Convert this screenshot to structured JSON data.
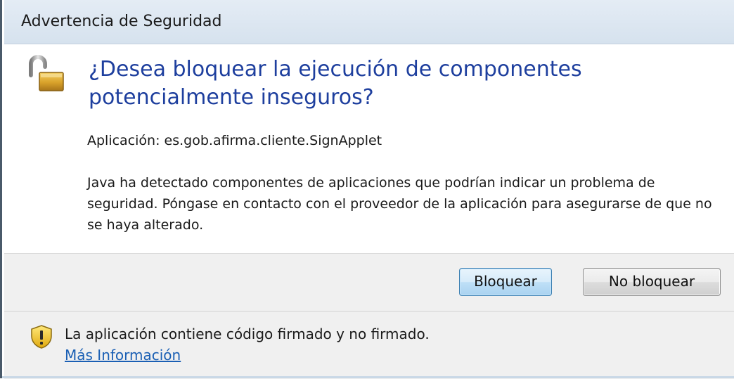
{
  "window": {
    "title": "Advertencia de Seguridad"
  },
  "content": {
    "heading": "¿Desea bloquear la ejecución de componentes potencialmente inseguros?",
    "application_line": "Aplicación: es.gob.afirma.cliente.SignApplet",
    "message": "Java ha detectado componentes de aplicaciones que podrían indicar un problema de seguridad. Póngase en contacto con el proveedor de la aplicación para asegurarse de que no se haya alterado.",
    "icon": "padlock-open-icon"
  },
  "buttons": {
    "block_label": "Bloquear",
    "dont_block_label": "No bloquear"
  },
  "footer": {
    "icon": "warning-shield-icon",
    "text": "La aplicación contiene código firmado y no firmado.",
    "link_label": "Más Información"
  },
  "colors": {
    "heading": "#1e3f9e",
    "link": "#1a5fb4",
    "titlebar": "#dae5f0",
    "footer_bg": "#f0f0f0",
    "primary_button_border": "#3c7fb1"
  }
}
